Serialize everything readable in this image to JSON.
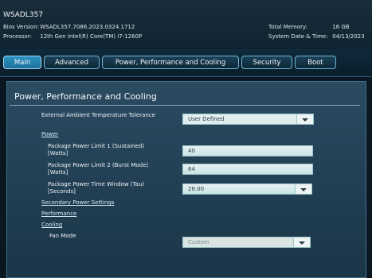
{
  "header": {
    "system_name": "WSADL357",
    "bios_label": "Bios Version:",
    "bios_value": "WSADL357.7086.2023.0324.1712",
    "processor_label": "Processor:",
    "processor_value": "12th Gen Intel(R) Core(TM) i7-1260P",
    "memory_label": "Total Memory:",
    "memory_value": "16 GB",
    "datetime_label": "System Date & Time:",
    "datetime_value": "04/13/2023"
  },
  "tabs": [
    {
      "label": "Main",
      "active": true
    },
    {
      "label": "Advanced",
      "active": false
    },
    {
      "label": "Power, Performance and Cooling",
      "active": false
    },
    {
      "label": "Security",
      "active": false
    },
    {
      "label": "Boot",
      "active": false
    }
  ],
  "panel": {
    "title": "Power, Performance and Cooling",
    "ambient_label": "External Ambient Temperature Tolerance",
    "ambient_value": "User Defined",
    "power_header": "Power",
    "pl1_label_line1": "Package Power Limit 1 (Sustained)",
    "pl1_label_line2": "[Watts]",
    "pl1_value": "40",
    "pl2_label_line1": "Package Power Limit 2 (Burst Mode)",
    "pl2_label_line2": "[Watts]",
    "pl2_value": "64",
    "tau_label_line1": "Package Power Time Window (Tau)",
    "tau_label_line2": "[Seconds]",
    "tau_value": "28.00",
    "secondary_link": "Secondary Power Settings",
    "performance_link": "Performance",
    "cooling_link": "Cooling",
    "fan_label": "Fan Mode",
    "fan_value": "Custom"
  }
}
